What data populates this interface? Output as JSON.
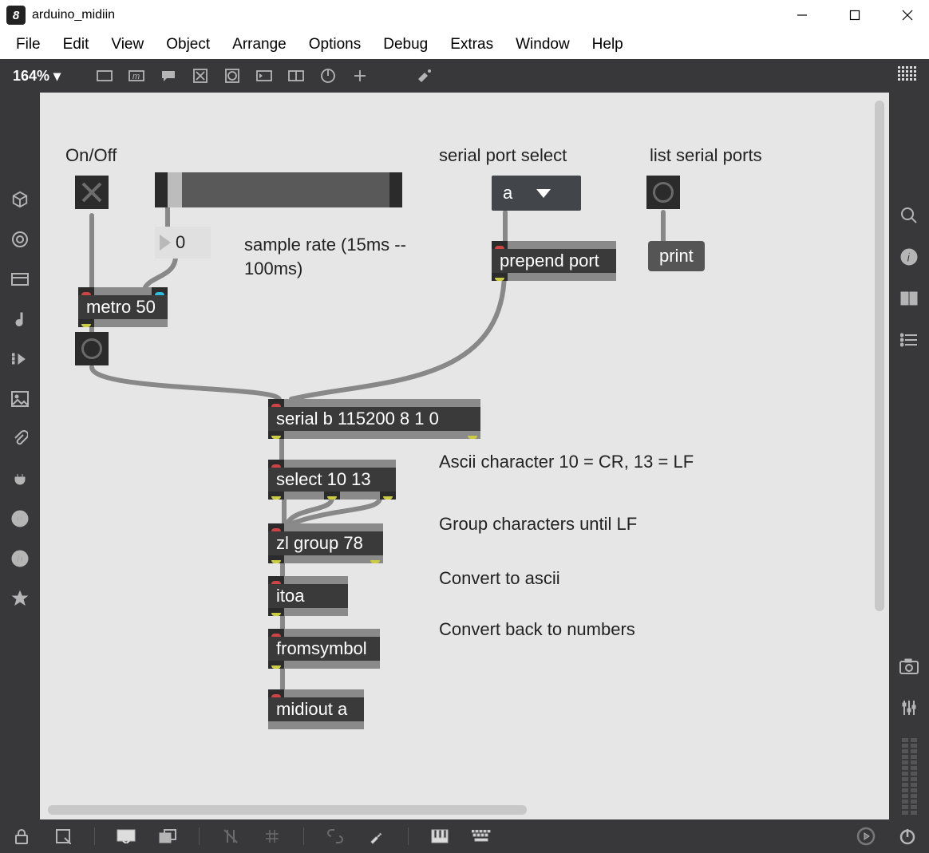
{
  "window": {
    "title": "arduino_midiin"
  },
  "menu": {
    "file": "File",
    "edit": "Edit",
    "view": "View",
    "object": "Object",
    "arrange": "Arrange",
    "options": "Options",
    "debug": "Debug",
    "extras": "Extras",
    "win": "Window",
    "help": "Help"
  },
  "topbar": {
    "zoom": "164% ▾"
  },
  "canvas": {
    "comments": {
      "onoff": "On/Off",
      "serial_select": "serial port select",
      "list_ports": "list serial ports",
      "sample_rate_l1": "sample rate (15ms --",
      "sample_rate_l2": "100ms)",
      "ascii_note": "Ascii character 10 = CR, 13 = LF",
      "group_note": "Group characters until LF",
      "itoa_note": "Convert to ascii",
      "fromsymbol_note": "Convert back to numbers"
    },
    "numbox_value": "0",
    "dropdown_value": "a",
    "objects": {
      "metro": "metro 50",
      "prepend": "prepend port",
      "print": "print",
      "serial": "serial b 115200 8 1 0",
      "select": "select 10 13",
      "zlgroup": "zl group 78",
      "itoa": "itoa",
      "fromsymbol": "fromsymbol",
      "midiout": "midiout a"
    }
  }
}
